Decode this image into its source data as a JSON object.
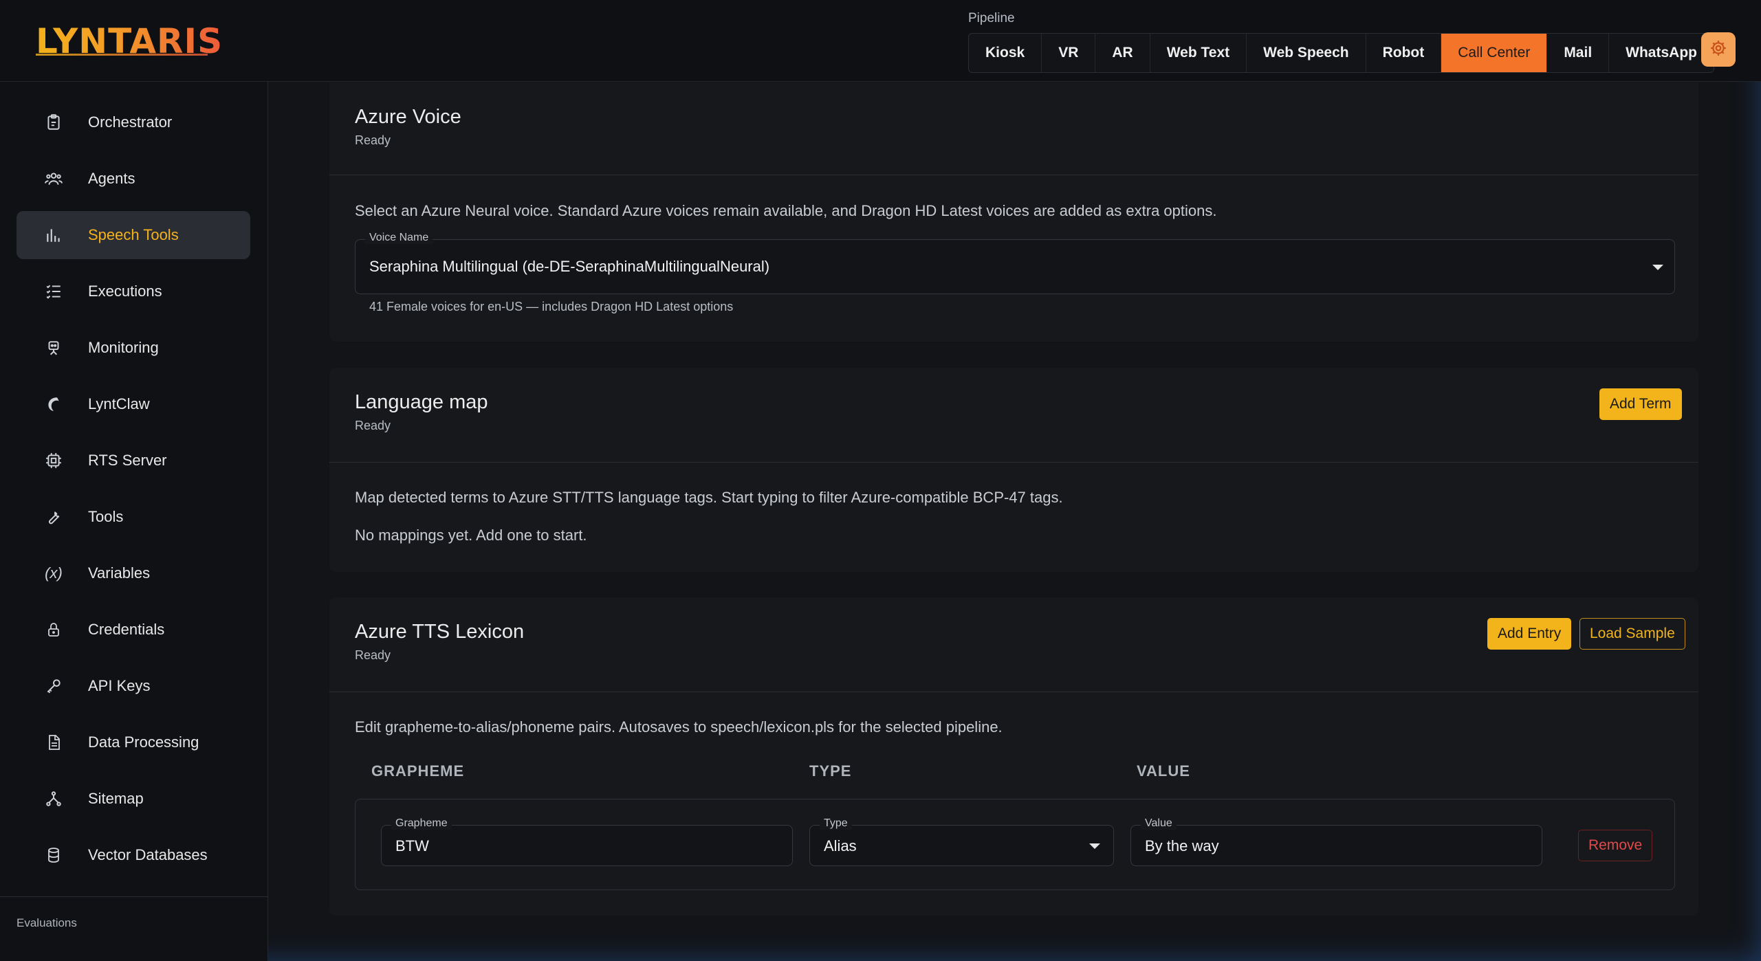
{
  "header": {
    "logo_text": "LYNTARIS",
    "pipeline_label": "Pipeline",
    "pipeline_tabs": [
      {
        "label": "Kiosk",
        "active": false
      },
      {
        "label": "VR",
        "active": false
      },
      {
        "label": "AR",
        "active": false
      },
      {
        "label": "Web Text",
        "active": false
      },
      {
        "label": "Web Speech",
        "active": false
      },
      {
        "label": "Robot",
        "active": false
      },
      {
        "label": "Call Center",
        "active": true
      },
      {
        "label": "Mail",
        "active": false
      },
      {
        "label": "WhatsApp",
        "active": false
      }
    ],
    "settings_icon": "gear-icon"
  },
  "sidebar": {
    "items": [
      {
        "label": "Orchestrator",
        "icon": "clipboard-icon"
      },
      {
        "label": "Agents",
        "icon": "users-icon"
      },
      {
        "label": "Speech Tools",
        "icon": "bar-chart-icon",
        "active": true
      },
      {
        "label": "Executions",
        "icon": "list-check-icon"
      },
      {
        "label": "Monitoring",
        "icon": "robot-icon"
      },
      {
        "label": "LyntClaw",
        "icon": "claw-icon"
      },
      {
        "label": "RTS Server",
        "icon": "server-icon"
      },
      {
        "label": "Tools",
        "icon": "wrench-icon"
      },
      {
        "label": "Variables",
        "icon": "variable-icon"
      },
      {
        "label": "Credentials",
        "icon": "lock-icon"
      },
      {
        "label": "API Keys",
        "icon": "key-icon"
      },
      {
        "label": "Data Processing",
        "icon": "document-icon"
      },
      {
        "label": "Sitemap",
        "icon": "sitemap-icon"
      },
      {
        "label": "Vector Databases",
        "icon": "database-icon"
      }
    ],
    "section_label": "Evaluations"
  },
  "azure_voice": {
    "title": "Azure Voice",
    "status": "Ready",
    "description": "Select an Azure Neural voice. Standard Azure voices remain available, and Dragon HD Latest voices are added as extra options.",
    "voice_field_label": "Voice Name",
    "voice_value": "Seraphina Multilingual (de-DE-SeraphinaMultilingualNeural)",
    "helper_text": "41 Female voices for en-US — includes Dragon HD Latest options"
  },
  "language_map": {
    "title": "Language map",
    "status": "Ready",
    "add_button": "Add Term",
    "description": "Map detected terms to Azure STT/TTS language tags. Start typing to filter Azure-compatible BCP-47 tags.",
    "empty_text": "No mappings yet. Add one to start."
  },
  "lexicon": {
    "title": "Azure TTS Lexicon",
    "status": "Ready",
    "add_button": "Add Entry",
    "load_button": "Load Sample",
    "description": "Edit grapheme-to-alias/phoneme pairs. Autosaves to speech/lexicon.pls for the selected pipeline.",
    "columns": [
      "GRAPHEME",
      "TYPE",
      "VALUE"
    ],
    "rows": [
      {
        "grapheme_label": "Grapheme",
        "grapheme": "BTW",
        "type_label": "Type",
        "type": "Alias",
        "value_label": "Value",
        "value": "By the way",
        "remove_label": "Remove"
      }
    ]
  },
  "colors": {
    "accent": "#f2b41a",
    "active_tab": "#f4742a",
    "danger": "#e04a4a"
  }
}
